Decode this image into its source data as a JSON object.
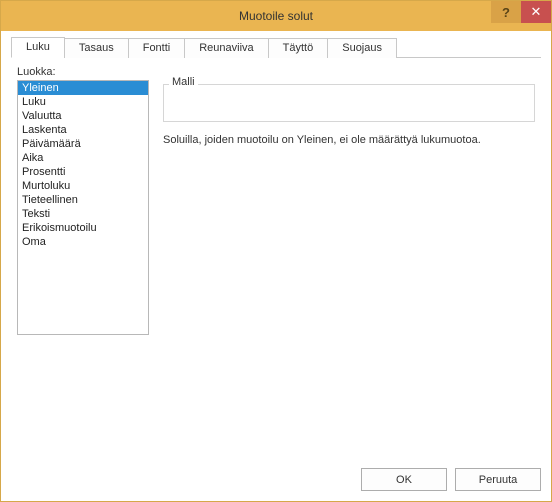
{
  "titlebar": {
    "title": "Muotoile solut",
    "help": "?",
    "close": "✕"
  },
  "tabs": {
    "items": [
      {
        "label": "Luku"
      },
      {
        "label": "Tasaus"
      },
      {
        "label": "Fontti"
      },
      {
        "label": "Reunaviiva"
      },
      {
        "label": "Täyttö"
      },
      {
        "label": "Suojaus"
      }
    ],
    "active_index": 0
  },
  "category": {
    "label": "Luokka:",
    "items": [
      "Yleinen",
      "Luku",
      "Valuutta",
      "Laskenta",
      "Päivämäärä",
      "Aika",
      "Prosentti",
      "Murtoluku",
      "Tieteellinen",
      "Teksti",
      "Erikoismuotoilu",
      "Oma"
    ],
    "selected_index": 0
  },
  "sample": {
    "label": "Malli"
  },
  "description": "Soluilla, joiden muotoilu on Yleinen, ei ole määrättyä lukumuotoa.",
  "buttons": {
    "ok": "OK",
    "cancel": "Peruuta"
  }
}
